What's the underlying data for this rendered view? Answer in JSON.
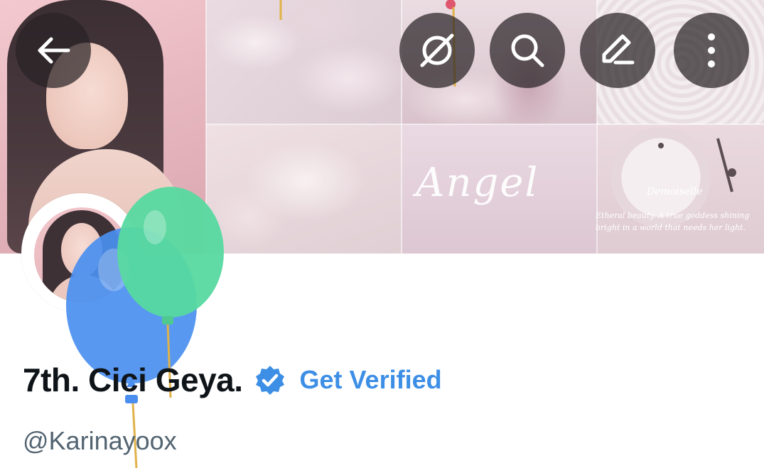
{
  "header": {
    "back_icon": "arrow-left-icon",
    "grok_icon": "grok-slash-icon",
    "search_icon": "search-icon",
    "edit_icon": "pencil-icon",
    "more_icon": "more-vertical-icon"
  },
  "banner": {
    "angel_text": "Angel",
    "demoiselle_text": "Demoiselle",
    "quote_line_1": "Etheral beauty. A true goddess shining",
    "quote_line_2": "bright in a world that needs her light."
  },
  "profile": {
    "display_name": "7th. Cici Geya.",
    "verified_icon": "verified-badge-icon",
    "get_verified_label": "Get Verified",
    "handle": "@Karinayoox"
  },
  "colors": {
    "accent": "#3d8fe6",
    "badge": "#3d8fe6",
    "name": "#0f1419",
    "handle": "#536471",
    "button_bg": "#282225",
    "balloon_blue": "#4a8ff0",
    "balloon_green": "#57d9a0"
  }
}
